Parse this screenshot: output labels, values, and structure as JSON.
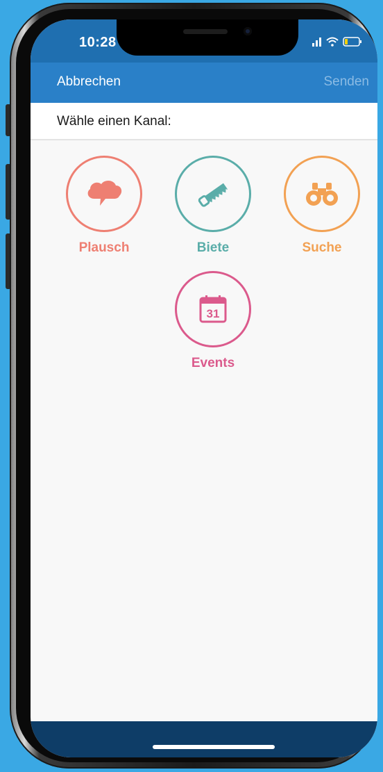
{
  "status_bar": {
    "time": "10:28",
    "icons": [
      "signal-icon",
      "wifi-icon",
      "battery-icon"
    ]
  },
  "nav": {
    "cancel_label": "Abbrechen",
    "send_label": "Senden"
  },
  "prompt": "Wähle einen Kanal:",
  "channels": [
    {
      "label": "Plausch",
      "icon": "speech-cloud-icon",
      "color": "#ee7f72"
    },
    {
      "label": "Biete",
      "icon": "saw-icon",
      "color": "#5aada9"
    },
    {
      "label": "Suche",
      "icon": "binoculars-icon",
      "color": "#f2a153"
    },
    {
      "label": "Events",
      "icon": "calendar-icon",
      "color": "#db5a8c",
      "icon_text": "31"
    }
  ],
  "colors": {
    "background": "#3aa8e4",
    "nav": "#2a80c8",
    "status_bar": "#1f6fb0",
    "bottom_bar": "#0e3d67"
  }
}
